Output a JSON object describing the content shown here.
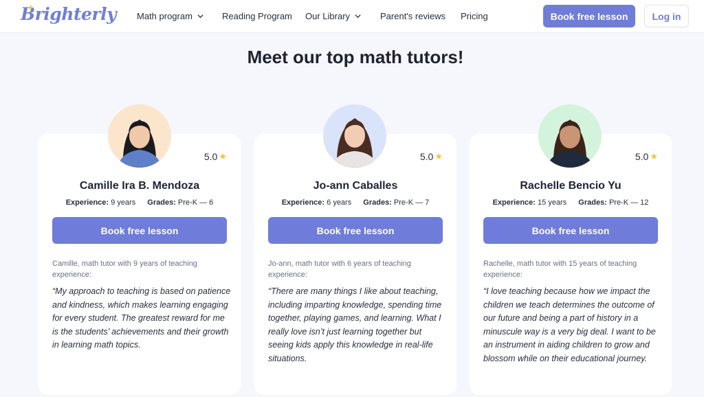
{
  "header": {
    "logo": "Brighterly",
    "nav": [
      {
        "label": "Math program",
        "has_dropdown": true
      },
      {
        "label": "Reading Program",
        "has_dropdown": false
      },
      {
        "label": "Our Library",
        "has_dropdown": true
      },
      {
        "label": "Parent's reviews",
        "has_dropdown": false
      },
      {
        "label": "Pricing",
        "has_dropdown": false
      }
    ],
    "book_button": "Book free lesson",
    "login_button": "Log in"
  },
  "page_title": "Meet our top math tutors!",
  "colors": {
    "accent": "#6f7cd9",
    "star": "#f5c33b",
    "background": "#f5f7fc"
  },
  "tutors": [
    {
      "name": "Camille Ira B. Mendoza",
      "rating": "5.0",
      "experience_label": "Experience:",
      "experience": "9 years",
      "grades_label": "Grades:",
      "grades": "Pre-K — 6",
      "button": "Book free lesson",
      "intro": "Camille, math tutor with 9 years of teaching experience:",
      "quote": "“My approach to teaching is based on patience and kindness, which makes learning engaging for every student. The greatest reward for me is the students’ achievements and their growth in learning math topics.",
      "avatar_bg": "#fbe6cc"
    },
    {
      "name": "Jo-ann Caballes",
      "rating": "5.0",
      "experience_label": "Experience:",
      "experience": "6 years",
      "grades_label": "Grades:",
      "grades": "Pre-K — 7",
      "button": "Book free lesson",
      "intro": "Jo-ann, math tutor with 6 years of teaching experience:",
      "quote": "“There are many things I like about teaching, including imparting knowledge, spending time together, playing games, and learning. What I really love isn’t just learning together but seeing kids apply this knowledge in real-life situations.",
      "avatar_bg": "#d9e4fb"
    },
    {
      "name": "Rachelle Bencio Yu",
      "rating": "5.0",
      "experience_label": "Experience:",
      "experience": "15 years",
      "grades_label": "Grades:",
      "grades": "Pre-K — 12",
      "button": "Book free lesson",
      "intro": "Rachelle, math tutor with 15 years of teaching experience:",
      "quote": "“I love teaching because how we impact the children we teach determines the outcome of our future and being a part of history in a minuscule way is a very big deal. I want to be an instrument in aiding children to grow and blossom while on their educational journey.",
      "avatar_bg": "#d4f3dd"
    }
  ]
}
